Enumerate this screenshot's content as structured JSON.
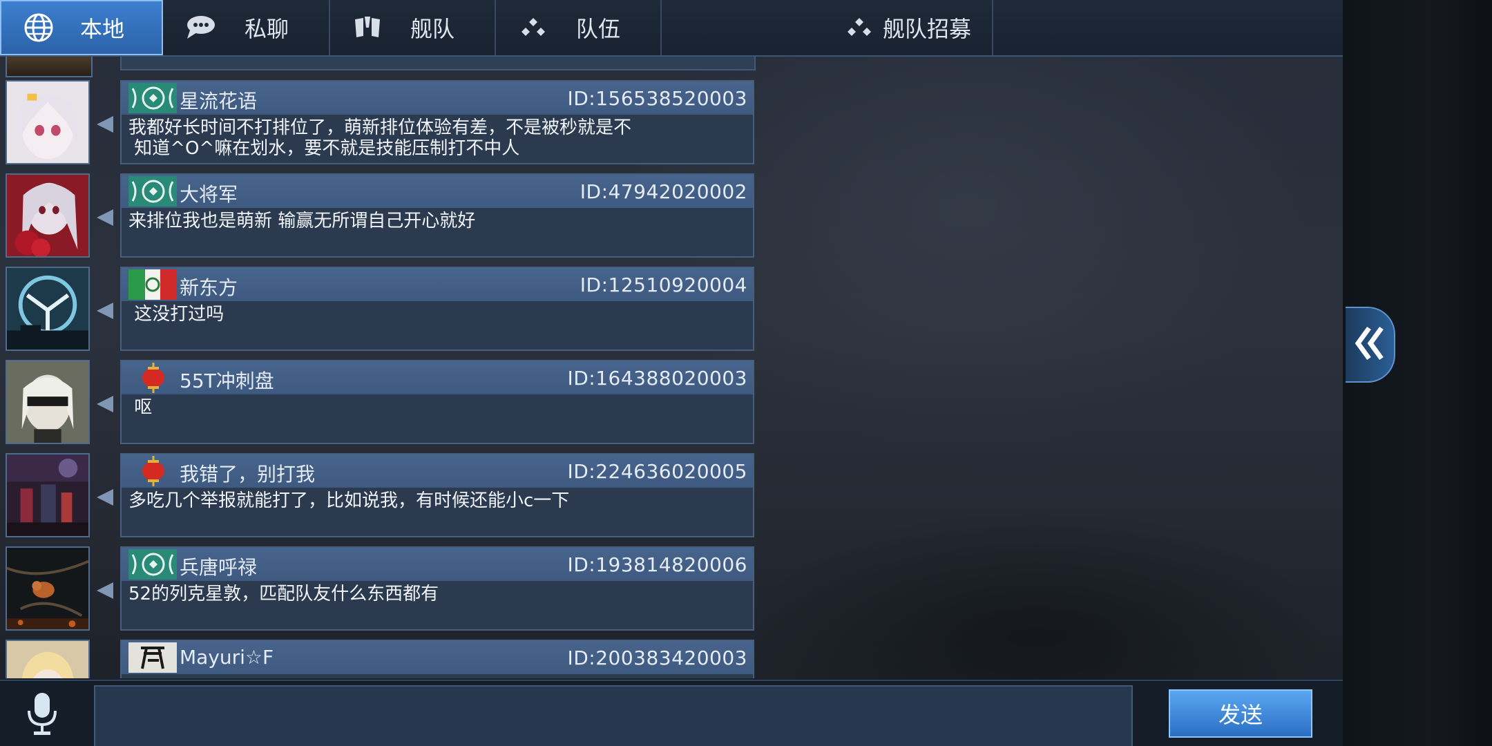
{
  "tabs": [
    {
      "label": "本地",
      "icon": "globe-icon",
      "active": true
    },
    {
      "label": "私聊",
      "icon": "chat-bubble-icon",
      "active": false
    },
    {
      "label": "舰队",
      "icon": "fleet-emblem-icon",
      "active": false
    },
    {
      "label": "队伍",
      "icon": "team-dots-icon",
      "active": false
    },
    {
      "label": "舰队招募",
      "icon": "team-dots-icon",
      "active": false
    }
  ],
  "messages": [
    {
      "name": "星流花语",
      "id": "ID:156538520003",
      "text": "我都好长时间不打排位了，萌新排位体验有差，不是被秒就是不\n 知道^O^嘛在划水，要不就是技能压制打不中人",
      "badge": "wreath-badge",
      "avatar": "white-hair-girl-avatar"
    },
    {
      "name": "大将军",
      "id": "ID:47942020002",
      "text": "来排位我也是萌新 输赢无所谓自己开心就好",
      "badge": "wreath-badge",
      "avatar": "red-roses-girl-avatar"
    },
    {
      "name": "新东方",
      "id": "ID:12510920004",
      "text": " 这没打过吗",
      "badge": "italy-flag-badge",
      "avatar": "emblem-avatar"
    },
    {
      "name": "55T冲刺盘",
      "id": "ID:164388020003",
      "text": " 呕",
      "badge": "lantern-badge",
      "avatar": "blindfold-girl-avatar"
    },
    {
      "name": "我错了，别打我",
      "id": "ID:224636020005",
      "text": "多吃几个举报就能打了，比如说我，有时候还能小c一下",
      "badge": "lantern-badge",
      "avatar": "party-scene-avatar"
    },
    {
      "name": "兵唐呼禄",
      "id": "ID:193814820006",
      "text": "52的列克星敦，匹配队友什么东西都有",
      "badge": "wreath-badge",
      "avatar": "bird-branch-avatar"
    },
    {
      "name": "Mayuri☆F",
      "id": "ID:200383420003",
      "text": "",
      "badge": "calligraphy-badge",
      "avatar": "blonde-girl-avatar"
    }
  ],
  "input": {
    "placeholder": "",
    "value": ""
  },
  "send_label": "发送",
  "colors": {
    "accent": "#3d7fd0",
    "bubble_header": "#47648c",
    "bubble_body": "#2b3a4f"
  }
}
